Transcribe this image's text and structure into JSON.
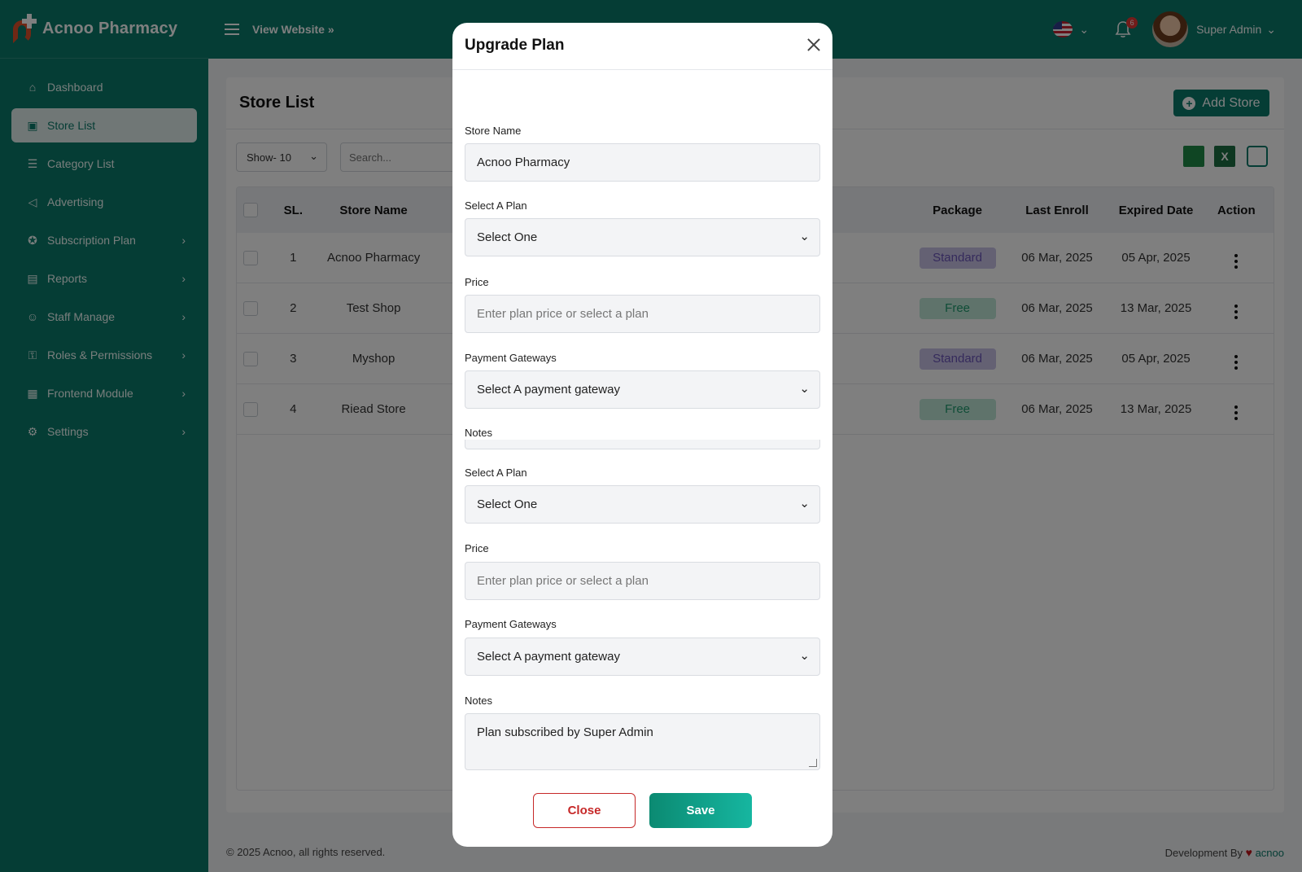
{
  "brand": {
    "name": "Acnoo Pharmacy"
  },
  "topbar": {
    "view_website": "View Website",
    "notification_count": "6",
    "user_name": "Super Admin"
  },
  "sidebar": {
    "items": [
      {
        "label": "Dashboard",
        "icon": "home-icon",
        "active": false,
        "has_children": false
      },
      {
        "label": "Store List",
        "icon": "store-icon",
        "active": true,
        "has_children": false
      },
      {
        "label": "Category List",
        "icon": "list-icon",
        "active": false,
        "has_children": false
      },
      {
        "label": "Advertising",
        "icon": "megaphone-icon",
        "active": false,
        "has_children": false
      },
      {
        "label": "Subscription Plan",
        "icon": "award-icon",
        "active": false,
        "has_children": true
      },
      {
        "label": "Reports",
        "icon": "report-icon",
        "active": false,
        "has_children": true
      },
      {
        "label": "Staff Manage",
        "icon": "users-icon",
        "active": false,
        "has_children": true
      },
      {
        "label": "Roles & Permissions",
        "icon": "user-lock-icon",
        "active": false,
        "has_children": true
      },
      {
        "label": "Frontend Module",
        "icon": "layout-icon",
        "active": false,
        "has_children": true
      },
      {
        "label": "Settings",
        "icon": "gear-icon",
        "active": false,
        "has_children": true
      }
    ]
  },
  "page": {
    "title": "Store List",
    "add_button": "Add Store",
    "show_select": "Show- 10",
    "search_placeholder": "Search...",
    "xls_label": "X"
  },
  "table": {
    "headers": {
      "sl": "SL.",
      "name": "Store Name",
      "package": "Package",
      "enroll": "Last Enroll",
      "expired": "Expired Date",
      "action": "Action"
    },
    "rows": [
      {
        "sl": "1",
        "name": "Acnoo Pharmacy",
        "package": "Standard",
        "enroll": "06 Mar, 2025",
        "expired": "05 Apr, 2025"
      },
      {
        "sl": "2",
        "name": "Test Shop",
        "package": "Free",
        "enroll": "06 Mar, 2025",
        "expired": "13 Mar, 2025"
      },
      {
        "sl": "3",
        "name": "Myshop",
        "package": "Standard",
        "enroll": "06 Mar, 2025",
        "expired": "05 Apr, 2025"
      },
      {
        "sl": "4",
        "name": "Riead Store",
        "package": "Free",
        "enroll": "06 Mar, 2025",
        "expired": "13 Mar, 2025"
      }
    ]
  },
  "colors": {
    "brand": "#0b7a6a",
    "standard_bg": "#c9c3e6",
    "standard_fg": "#6a55b8",
    "free_bg": "#bfe6d6",
    "free_fg": "#1f9a6e"
  },
  "modal": {
    "title": "Upgrade Plan",
    "store_name_label": "Store Name",
    "store_name_value": "Acnoo Pharmacy",
    "plan_label": "Select A Plan",
    "plan_value": "Select One",
    "price_label": "Price",
    "price_placeholder": "Enter plan price or select a plan",
    "gateway_label": "Payment Gateways",
    "gateway_value": "Select A payment gateway",
    "notes_label": "Notes",
    "notes_value": "Plan subscribed by Super Admin",
    "close_button": "Close",
    "save_button": "Save"
  },
  "footer": {
    "copyright": "© 2025 Acnoo, all rights reserved.",
    "dev_by": "Development By",
    "dev_brand": "acnoo"
  }
}
